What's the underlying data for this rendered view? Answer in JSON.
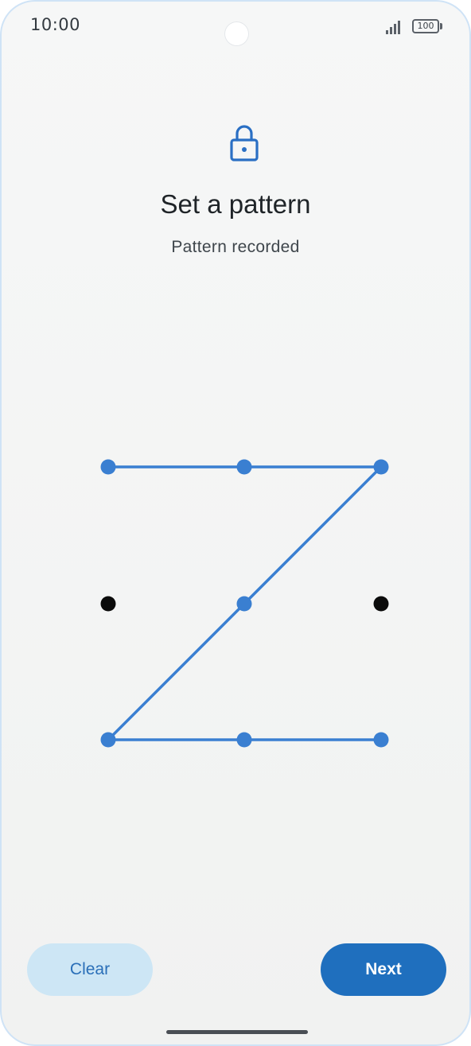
{
  "status_bar": {
    "time": "10:00",
    "battery_level": "100",
    "signal_icon": "signal-bars-icon"
  },
  "header": {
    "icon": "lock-icon",
    "title": "Set a pattern",
    "subtitle": "Pattern recorded"
  },
  "pattern": {
    "grid_size": 3,
    "selected_sequence": [
      1,
      2,
      3,
      5,
      7,
      8,
      9
    ],
    "colors": {
      "selected": "#3a7fd1",
      "unselected": "#0b0b0b",
      "line": "#3a7fd1"
    }
  },
  "actions": {
    "clear_label": "Clear",
    "next_label": "Next"
  },
  "colors": {
    "accent": "#1f6fbe",
    "secondary_button_bg": "#cde6f5"
  }
}
